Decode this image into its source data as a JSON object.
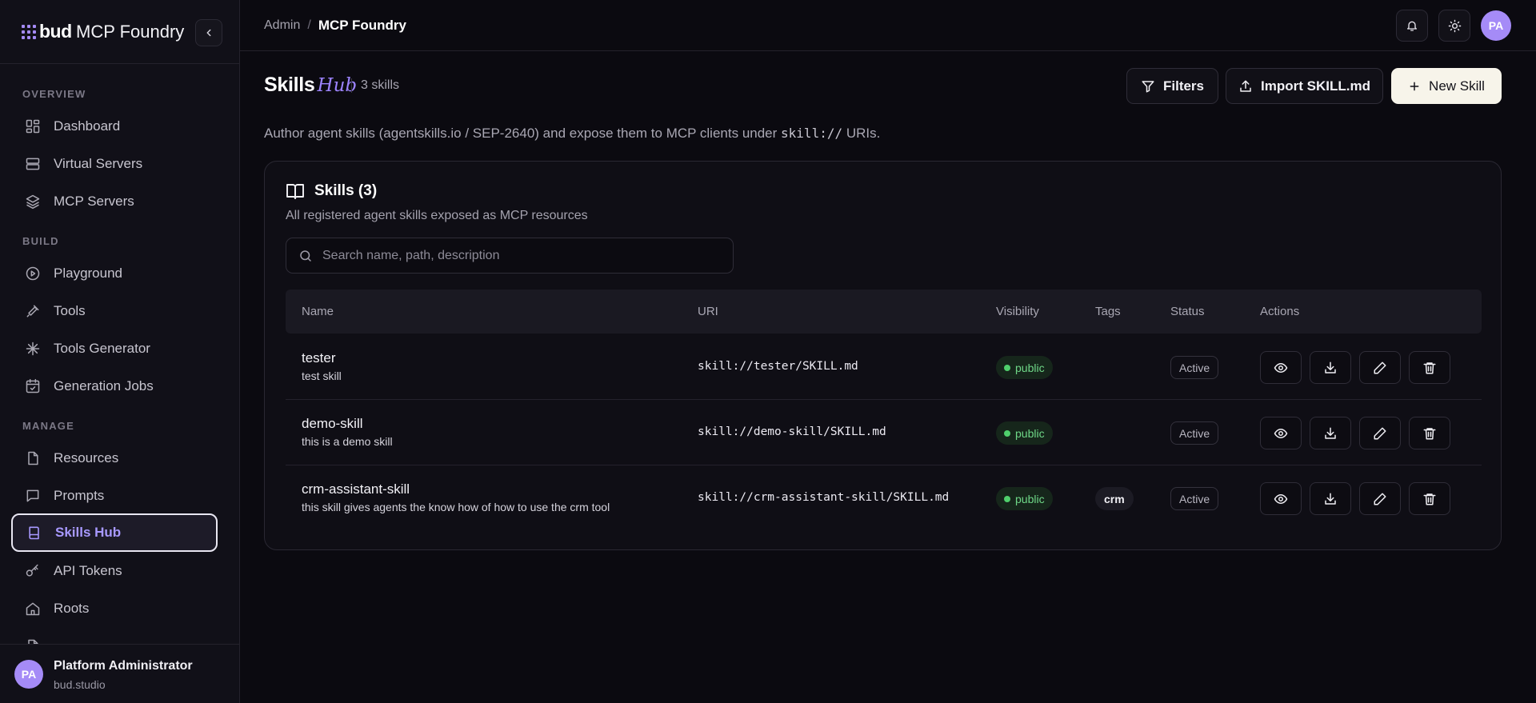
{
  "brand": {
    "logo_word": "bud",
    "app_name": "MCP Foundry"
  },
  "sidebar": {
    "sections": [
      {
        "title": "OVERVIEW",
        "items": [
          {
            "label": "Dashboard",
            "icon": "dashboard-icon"
          },
          {
            "label": "Virtual Servers",
            "icon": "server-icon"
          },
          {
            "label": "MCP Servers",
            "icon": "layers-icon"
          }
        ]
      },
      {
        "title": "BUILD",
        "items": [
          {
            "label": "Playground",
            "icon": "play-icon"
          },
          {
            "label": "Tools",
            "icon": "hammer-icon"
          },
          {
            "label": "Tools Generator",
            "icon": "sparkle-icon"
          },
          {
            "label": "Generation Jobs",
            "icon": "calendar-check-icon"
          }
        ]
      },
      {
        "title": "MANAGE",
        "items": [
          {
            "label": "Resources",
            "icon": "file-icon"
          },
          {
            "label": "Prompts",
            "icon": "message-icon"
          },
          {
            "label": "Skills Hub",
            "icon": "book-icon",
            "active": true
          },
          {
            "label": "API Tokens",
            "icon": "key-icon"
          },
          {
            "label": "Roots",
            "icon": "home-icon"
          }
        ]
      }
    ],
    "user": {
      "initials": "PA",
      "name": "Platform Administrator",
      "org": "bud.studio"
    }
  },
  "topbar": {
    "breadcrumb": [
      "Admin",
      "MCP Foundry"
    ],
    "breadcrumb_separator": "/",
    "avatar_initials": "PA"
  },
  "page": {
    "title": "Skills",
    "title_accent": "Hub",
    "count": "3 skills",
    "subtitle_pre": "Author agent skills (agentskills.io / SEP-2640) and expose them to MCP clients under ",
    "subtitle_code": "skill://",
    "subtitle_post": " URIs.",
    "buttons": {
      "filters": "Filters",
      "import": "Import SKILL.md",
      "new": "New Skill"
    }
  },
  "card": {
    "title": "Skills (3)",
    "description": "All registered agent skills exposed as MCP resources",
    "search_placeholder": "Search name, path, description",
    "columns": [
      "Name",
      "URI",
      "Visibility",
      "Tags",
      "Status",
      "Actions"
    ],
    "rows": [
      {
        "name": "tester",
        "description": "test skill",
        "uri": "skill://tester/SKILL.md",
        "visibility": "public",
        "tag": "",
        "status": "Active"
      },
      {
        "name": "demo-skill",
        "description": "this is a demo skill",
        "uri": "skill://demo-skill/SKILL.md",
        "visibility": "public",
        "tag": "",
        "status": "Active"
      },
      {
        "name": "crm-assistant-skill",
        "description": "this skill gives agents the know how of how to use the crm tool",
        "uri": "skill://crm-assistant-skill/SKILL.md",
        "visibility": "public",
        "tag": "crm",
        "status": "Active"
      }
    ]
  },
  "colors": {
    "accent": "#9d84ff",
    "active_nav_text": "#a899ff",
    "public_green": "#6fd888",
    "background": "#0b0a10"
  }
}
